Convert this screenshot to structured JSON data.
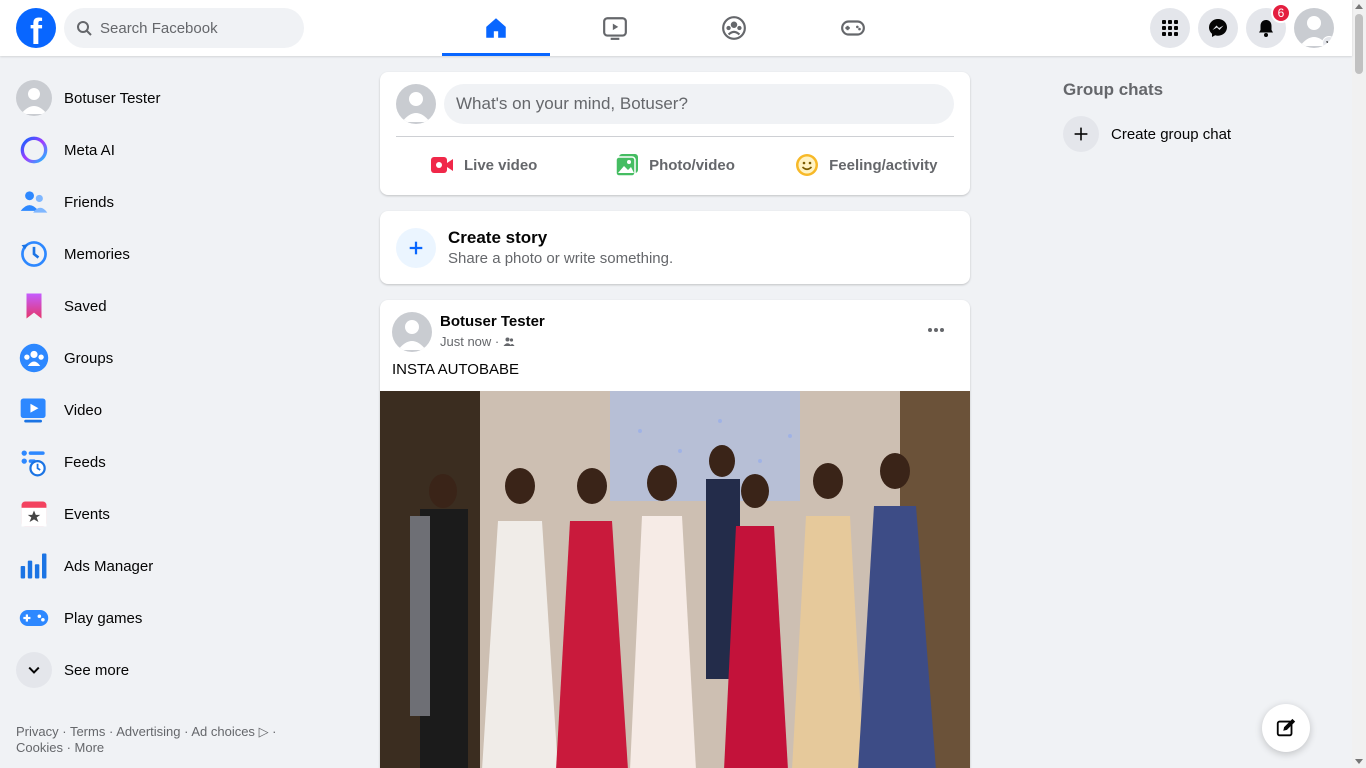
{
  "header": {
    "search_placeholder": "Search Facebook",
    "notifications_count": "6",
    "nav_tabs": [
      "home",
      "video",
      "groups",
      "gaming"
    ]
  },
  "sidebar": {
    "items": [
      {
        "label": "Botuser Tester",
        "icon": "avatar"
      },
      {
        "label": "Meta AI",
        "icon": "meta-ai-icon"
      },
      {
        "label": "Friends",
        "icon": "friends-icon"
      },
      {
        "label": "Memories",
        "icon": "memories-icon"
      },
      {
        "label": "Saved",
        "icon": "saved-icon"
      },
      {
        "label": "Groups",
        "icon": "groups-icon"
      },
      {
        "label": "Video",
        "icon": "video-icon"
      },
      {
        "label": "Feeds",
        "icon": "feeds-icon"
      },
      {
        "label": "Events",
        "icon": "events-icon"
      },
      {
        "label": "Ads Manager",
        "icon": "ads-manager-icon"
      },
      {
        "label": "Play games",
        "icon": "play-games-icon"
      },
      {
        "label": "See more",
        "icon": "chevron-down-icon"
      }
    ],
    "footer": {
      "privacy": "Privacy",
      "terms": "Terms",
      "advertising": "Advertising",
      "ad_choices": "Ad choices",
      "cookies": "Cookies",
      "more": "More"
    }
  },
  "composer": {
    "placeholder": "What's on your mind, Botuser?",
    "live_video": "Live video",
    "photo_video": "Photo/video",
    "feeling": "Feeling/activity"
  },
  "story": {
    "title": "Create story",
    "subtitle": "Share a photo or write something."
  },
  "post": {
    "author": "Botuser Tester",
    "time": "Just now ·",
    "text": "INSTA AUTOBABE"
  },
  "right": {
    "heading": "Group chats",
    "create_label": "Create group chat"
  },
  "colors": {
    "brand": "#0866ff",
    "badge": "#e41e3f"
  }
}
